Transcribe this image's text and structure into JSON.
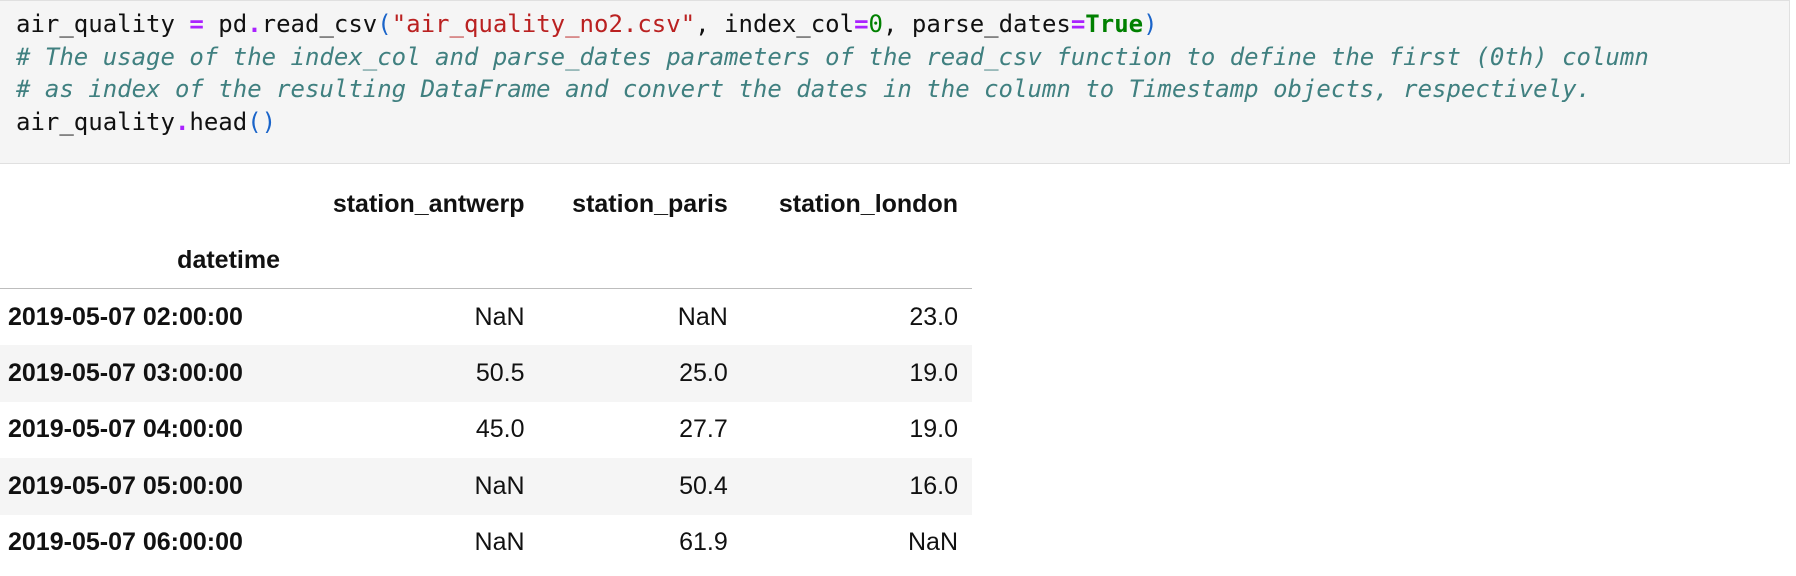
{
  "code_cell": {
    "lines": [
      [
        {
          "text": "air_quality ",
          "cls": "tok-plain"
        },
        {
          "text": "=",
          "cls": "tok-op"
        },
        {
          "text": " pd",
          "cls": "tok-plain"
        },
        {
          "text": ".",
          "cls": "tok-op"
        },
        {
          "text": "read_csv",
          "cls": "tok-plain"
        },
        {
          "text": "(",
          "cls": "tok-paren"
        },
        {
          "text": "\"air_quality_no2.csv\"",
          "cls": "tok-str"
        },
        {
          "text": ", index_col",
          "cls": "tok-plain"
        },
        {
          "text": "=",
          "cls": "tok-op"
        },
        {
          "text": "0",
          "cls": "tok-num"
        },
        {
          "text": ", parse_dates",
          "cls": "tok-plain"
        },
        {
          "text": "=",
          "cls": "tok-op"
        },
        {
          "text": "True",
          "cls": "tok-kw"
        },
        {
          "text": ")",
          "cls": "tok-paren"
        }
      ],
      [
        {
          "text": "# The usage of the index_col and parse_dates parameters of the read_csv function to define the first (0th) column",
          "cls": "tok-comment"
        }
      ],
      [
        {
          "text": "# as index of the resulting DataFrame and convert the dates in the column to Timestamp objects, respectively.",
          "cls": "tok-comment"
        }
      ],
      [
        {
          "text": "air_quality",
          "cls": "tok-plain"
        },
        {
          "text": ".",
          "cls": "tok-op"
        },
        {
          "text": "head",
          "cls": "tok-plain"
        },
        {
          "text": "()",
          "cls": "tok-paren"
        }
      ]
    ]
  },
  "output_table": {
    "index_name": "datetime",
    "columns": [
      "station_antwerp",
      "station_paris",
      "station_london"
    ],
    "rows": [
      {
        "index": "2019-05-07 02:00:00",
        "values": [
          "NaN",
          "NaN",
          "23.0"
        ]
      },
      {
        "index": "2019-05-07 03:00:00",
        "values": [
          "50.5",
          "25.0",
          "19.0"
        ]
      },
      {
        "index": "2019-05-07 04:00:00",
        "values": [
          "45.0",
          "27.7",
          "19.0"
        ]
      },
      {
        "index": "2019-05-07 05:00:00",
        "values": [
          "NaN",
          "50.4",
          "16.0"
        ]
      },
      {
        "index": "2019-05-07 06:00:00",
        "values": [
          "NaN",
          "61.9",
          "NaN"
        ]
      }
    ]
  }
}
